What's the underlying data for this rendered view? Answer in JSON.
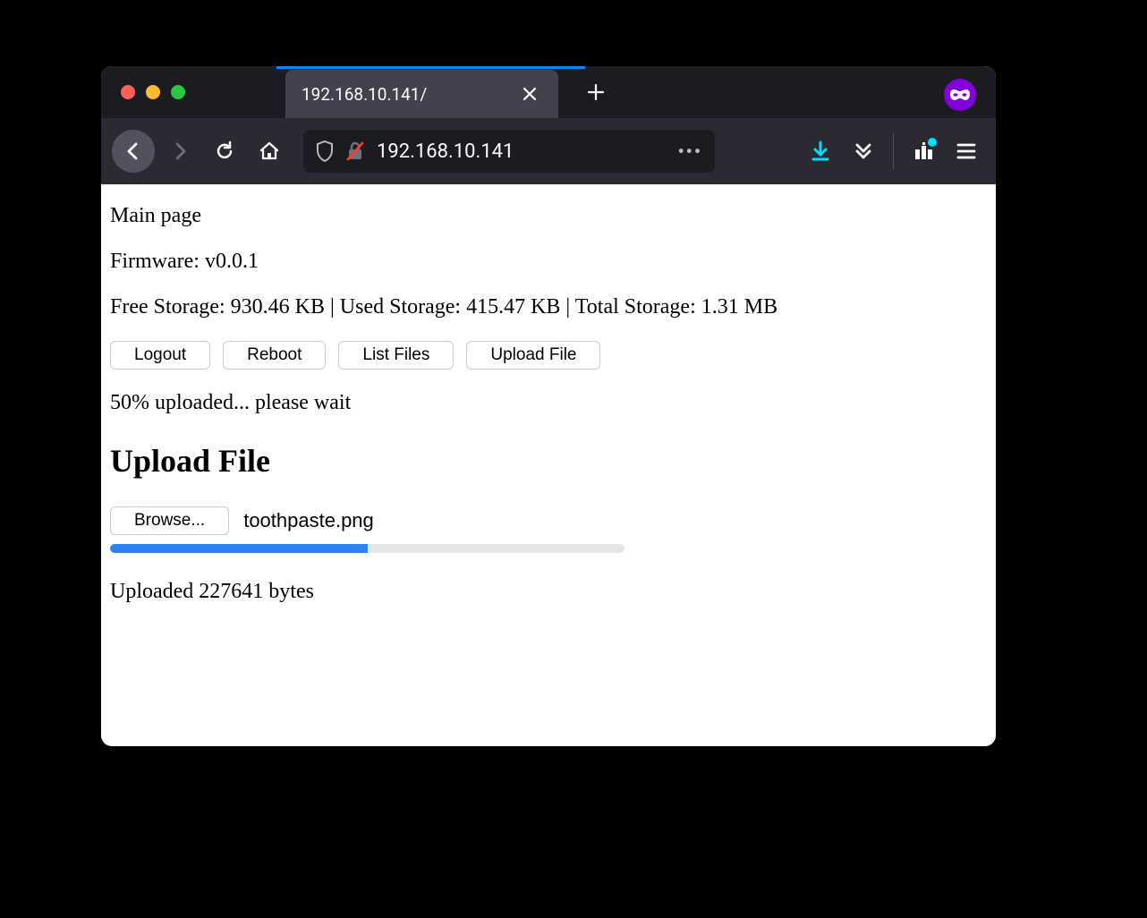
{
  "browser": {
    "tab_title": "192.168.10.141/",
    "url": "192.168.10.141"
  },
  "page": {
    "title": "Main page",
    "firmware_line": "Firmware: v0.0.1",
    "storage_line": "Free Storage: 930.46 KB | Used Storage: 415.47 KB | Total Storage: 1.31 MB",
    "buttons": {
      "logout": "Logout",
      "reboot": "Reboot",
      "list_files": "List Files",
      "upload_file": "Upload File"
    },
    "upload_status": "50% uploaded... please wait",
    "upload_heading": "Upload File",
    "browse_label": "Browse...",
    "selected_file": "toothpaste.png",
    "progress_percent": 50,
    "uploaded_line": "Uploaded 227641 bytes"
  }
}
